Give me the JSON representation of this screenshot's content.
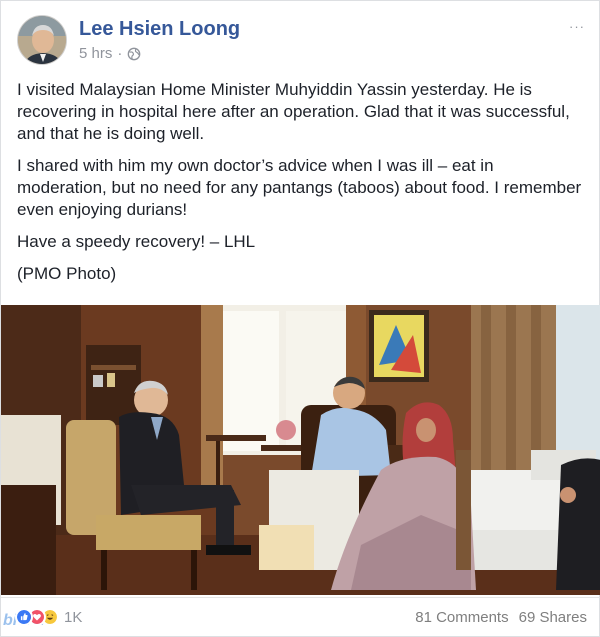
{
  "post": {
    "author": "Lee Hsien Loong",
    "timestamp": "5 hrs",
    "separator": "·",
    "privacy_icon": "globe-icon",
    "more_label": "···",
    "paragraphs": [
      "I visited Malaysian Home Minister Muhyiddin Yassin yesterday. He is recovering in hospital here after an operation. Glad that it was successful, and that he is doing well.",
      "I shared with him my own doctor’s advice when I was ill – eat in moderation, but no need for any pantangs (taboos) about food. I remember even enjoying durians!",
      "Have a speedy recovery! – LHL",
      "(PMO Photo)"
    ]
  },
  "footer": {
    "reaction_count": "1K",
    "comments": "81 Comments",
    "shares": "69 Shares",
    "watermark": "bicfen"
  },
  "colors": {
    "author": "#365899",
    "like": "#3b79f5",
    "love": "#f25268",
    "haha": "#f7c83d"
  }
}
